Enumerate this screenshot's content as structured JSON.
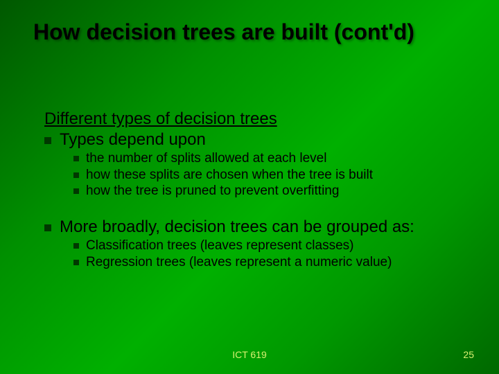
{
  "title": "How decision trees are built (cont'd)",
  "subheading": "Different types of decision trees",
  "bullets": {
    "b1": "Types depend upon",
    "b1a": "the number of splits allowed at each level",
    "b1b": "how these splits are chosen when the tree is built",
    "b1c": "how the tree is pruned to prevent overfitting",
    "b2": "More broadly, decision trees can be grouped as:",
    "b2a": "Classification trees (leaves represent classes)",
    "b2b": "Regression trees (leaves represent a numeric value)"
  },
  "footer": {
    "course": "ICT 619",
    "page": "25"
  }
}
